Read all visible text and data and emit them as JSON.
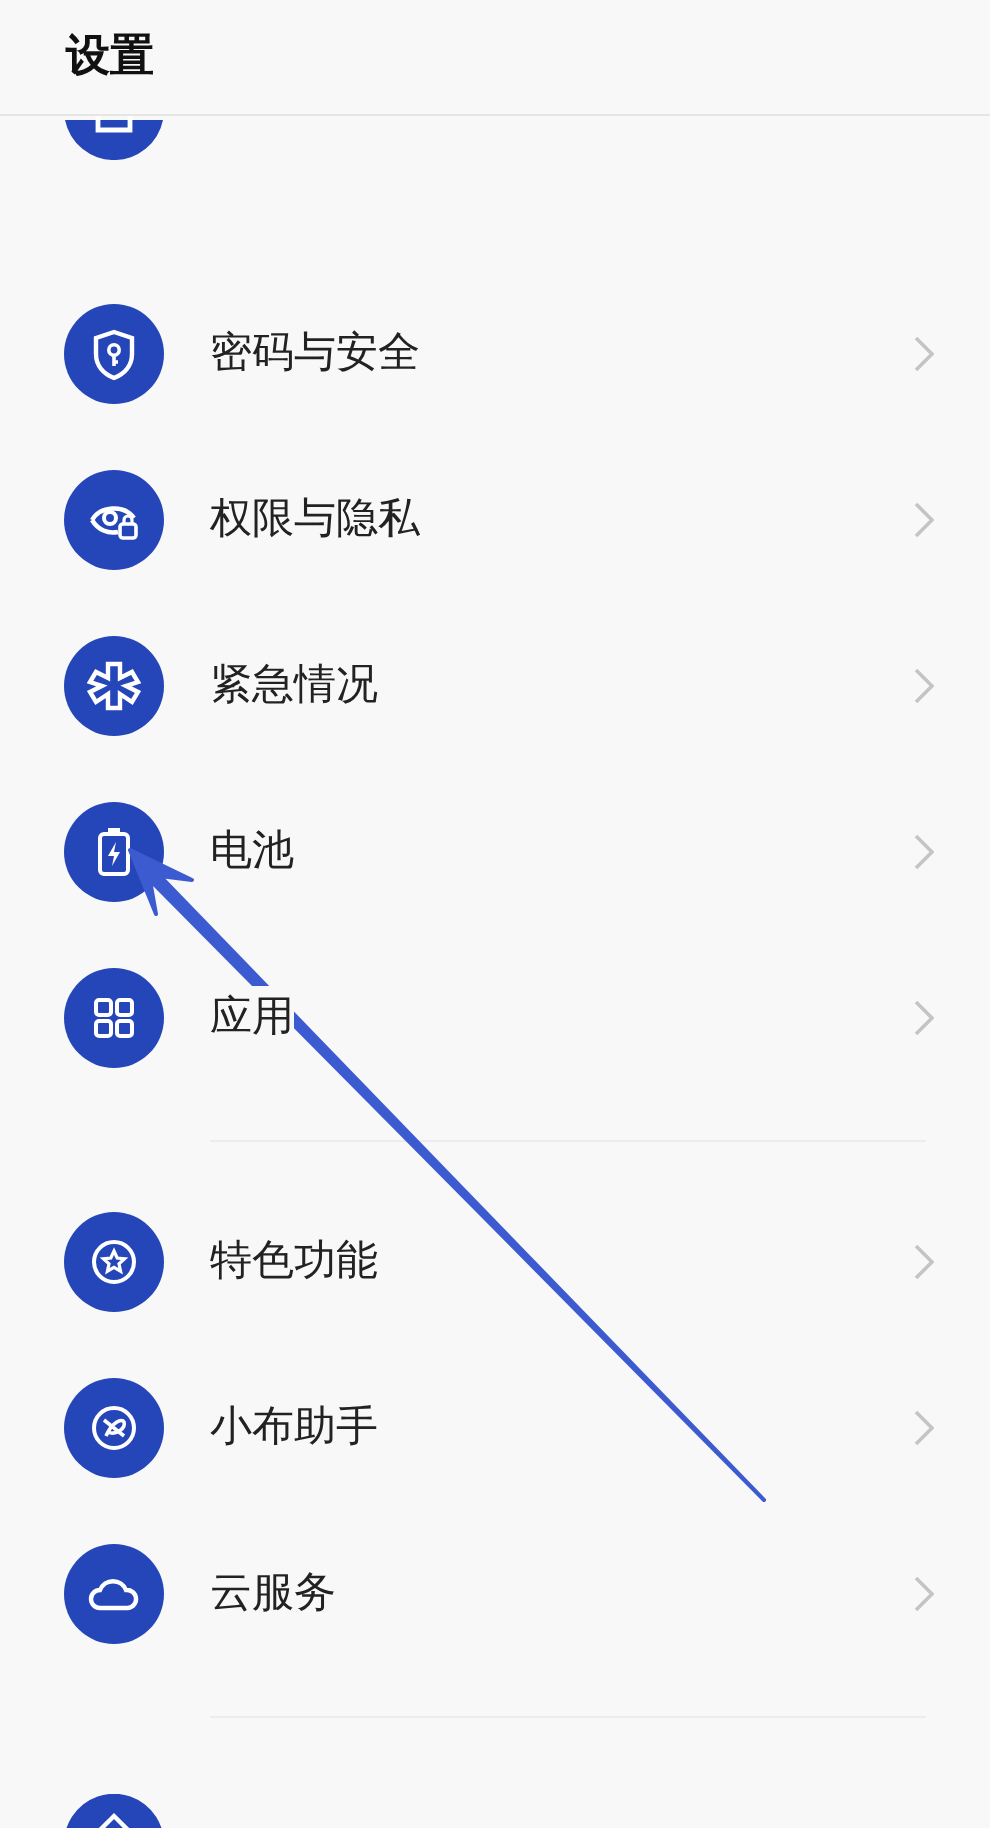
{
  "header": {
    "title": "设置"
  },
  "groups": [
    {
      "items": [
        {
          "label": "密码与安全"
        },
        {
          "label": "权限与隐私"
        },
        {
          "label": "紧急情况"
        },
        {
          "label": "电池"
        },
        {
          "label": "应用"
        }
      ]
    },
    {
      "items": [
        {
          "label": "特色功能"
        },
        {
          "label": "小布助手"
        },
        {
          "label": "云服务"
        }
      ]
    }
  ]
}
